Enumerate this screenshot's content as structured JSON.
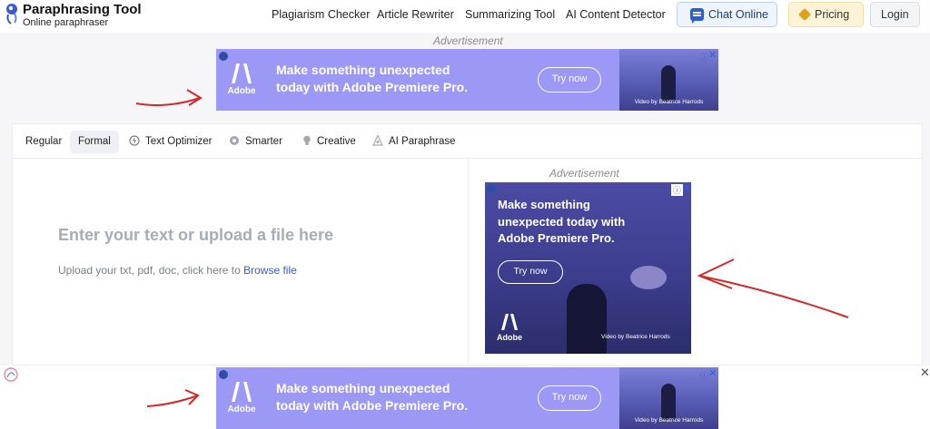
{
  "header": {
    "logo_title": "Paraphrasing Tool",
    "logo_subtitle": "Online paraphraser",
    "nav": [
      "Plagiarism Checker",
      "Article Rewriter",
      "Summarizing Tool",
      "AI Content Detector"
    ],
    "chat_label": "Chat Online",
    "pricing_label": "Pricing",
    "login_label": "Login"
  },
  "ads": {
    "label": "Advertisement",
    "headline_line1": "Make something unexpected",
    "headline_line2": "today with Adobe Premiere Pro.",
    "box_headline": "Make something unexpected today with Adobe Premiere Pro.",
    "cta": "Try now",
    "brand": "Adobe",
    "credit": "Video by Beatrice Harrods",
    "info_icon": "info-icon",
    "close_icon": "close-icon"
  },
  "editor": {
    "tabs": [
      "Regular",
      "Formal",
      "Text Optimizer",
      "Smarter",
      "Creative",
      "AI Paraphrase"
    ],
    "active_tab": "Formal",
    "placeholder": "Enter your text or upload a file here",
    "upload_text": "Upload your txt, pdf, doc, click here to",
    "browse_link": "Browse file"
  },
  "bottom_strip": {
    "close_symbol": "✕"
  },
  "colors": {
    "ad_banner": "#9c98f5",
    "link": "#3d5bc9",
    "annotation_arrow": "#d12a2a"
  }
}
